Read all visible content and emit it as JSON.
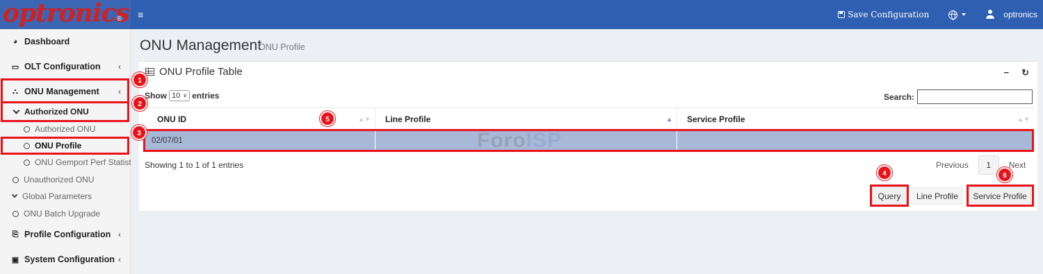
{
  "brand": {
    "logo_text": "optronics",
    "logo_mark": "®"
  },
  "topbar": {
    "menu_icon": "hamburger-icon",
    "save_label": "Save Configuration",
    "language_icon": "globe-icon",
    "username": "optronics"
  },
  "sidebar": {
    "items": [
      {
        "label": "Dashboard",
        "icon": "dashboard-icon"
      },
      {
        "label": "OLT Configuration",
        "icon": "laptop-icon"
      },
      {
        "label": "ONU Management",
        "icon": "sitemap-icon"
      },
      {
        "label": "Authorized ONU"
      },
      {
        "label": "Authorized ONU"
      },
      {
        "label": "ONU Profile"
      },
      {
        "label": "ONU Gemport Perf Statistic"
      },
      {
        "label": "Unauthorized ONU"
      },
      {
        "label": "Global Parameters"
      },
      {
        "label": "ONU Batch Upgrade"
      },
      {
        "label": "Profile Configuration",
        "icon": "profile-icon"
      },
      {
        "label": "System Configuration",
        "icon": "save-icon"
      }
    ]
  },
  "page": {
    "title": "ONU Management",
    "subtitle": "ONU Profile"
  },
  "box": {
    "title": "ONU Profile Table",
    "show_prefix": "Show",
    "show_value": "10",
    "show_suffix": "entries",
    "search_label": "Search:",
    "search_value": ""
  },
  "table": {
    "columns": [
      "ONU ID",
      "Line Profile",
      "Service Profile"
    ],
    "rows": [
      [
        "02/07/01",
        "",
        ""
      ]
    ]
  },
  "watermark": {
    "part1": "Foro",
    "part2": "ISP"
  },
  "footer": {
    "info": "Showing 1 to 1 of 1 entries",
    "previous": "Previous",
    "page": "1",
    "next": "Next"
  },
  "actions": {
    "query": "Query",
    "line_profile": "Line Profile",
    "service_profile": "Service Profile"
  },
  "annotations": [
    "1",
    "2",
    "3",
    "4",
    "5",
    "6"
  ],
  "colors": {
    "topbar": "#2f5fb0",
    "logo_text": "#d32020",
    "highlight": "#e8121a",
    "selected_row": "#a8b9d8"
  }
}
